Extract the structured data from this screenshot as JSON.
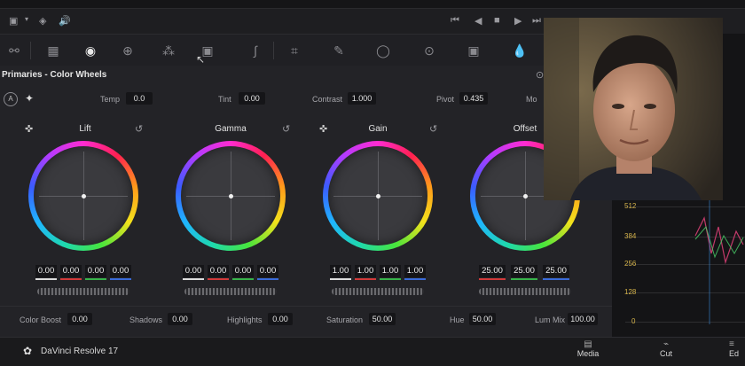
{
  "panel": {
    "title": "Primaries - Color Wheels",
    "mode_badge": "A",
    "adjust": [
      {
        "label": "Temp",
        "value": "0.0"
      },
      {
        "label": "Tint",
        "value": "0.00"
      },
      {
        "label": "Contrast",
        "value": "1.000"
      },
      {
        "label": "Pivot",
        "value": "0.435"
      },
      {
        "label": "Mo",
        "value": ""
      }
    ],
    "wheels": [
      {
        "name": "Lift",
        "values": [
          "0.00",
          "0.00",
          "0.00",
          "0.00"
        ]
      },
      {
        "name": "Gamma",
        "values": [
          "0.00",
          "0.00",
          "0.00",
          "0.00"
        ]
      },
      {
        "name": "Gain",
        "values": [
          "1.00",
          "1.00",
          "1.00",
          "1.00"
        ]
      },
      {
        "name": "Offset",
        "values": [
          "25.00",
          "25.00",
          "25.00"
        ]
      }
    ],
    "bottom_params": [
      {
        "label": "Color Boost",
        "value": "0.00"
      },
      {
        "label": "Shadows",
        "value": "0.00"
      },
      {
        "label": "Highlights",
        "value": "0.00"
      },
      {
        "label": "Saturation",
        "value": "50.00"
      },
      {
        "label": "Hue",
        "value": "50.00"
      },
      {
        "label": "Lum Mix",
        "value": "100.00"
      }
    ]
  },
  "scope": {
    "ticks": [
      "512",
      "384",
      "256",
      "128",
      "0"
    ]
  },
  "footer": {
    "app_name": "DaVinci Resolve 17",
    "pages": [
      "Media",
      "Cut",
      "Ed"
    ]
  },
  "icons": {
    "transport": [
      "skip-back-icon",
      "step-back-icon",
      "stop-icon",
      "play-icon",
      "skip-forward-icon"
    ],
    "toolbar": [
      "curves-icon",
      "raw-icon",
      "color-wheels-icon",
      "hdr-icon",
      "rgb-mixer-icon",
      "motion-effects-icon",
      "curves-tool-icon",
      "warper-icon",
      "qualifier-icon",
      "window-icon",
      "tracker-icon",
      "magic-mask-icon",
      "blur-icon",
      "key-icon",
      "sizing-icon"
    ]
  },
  "colors": {
    "accent": "#e0e0e0",
    "red": "#d23a3a",
    "green": "#37b34a",
    "blue": "#3a6bd8"
  }
}
